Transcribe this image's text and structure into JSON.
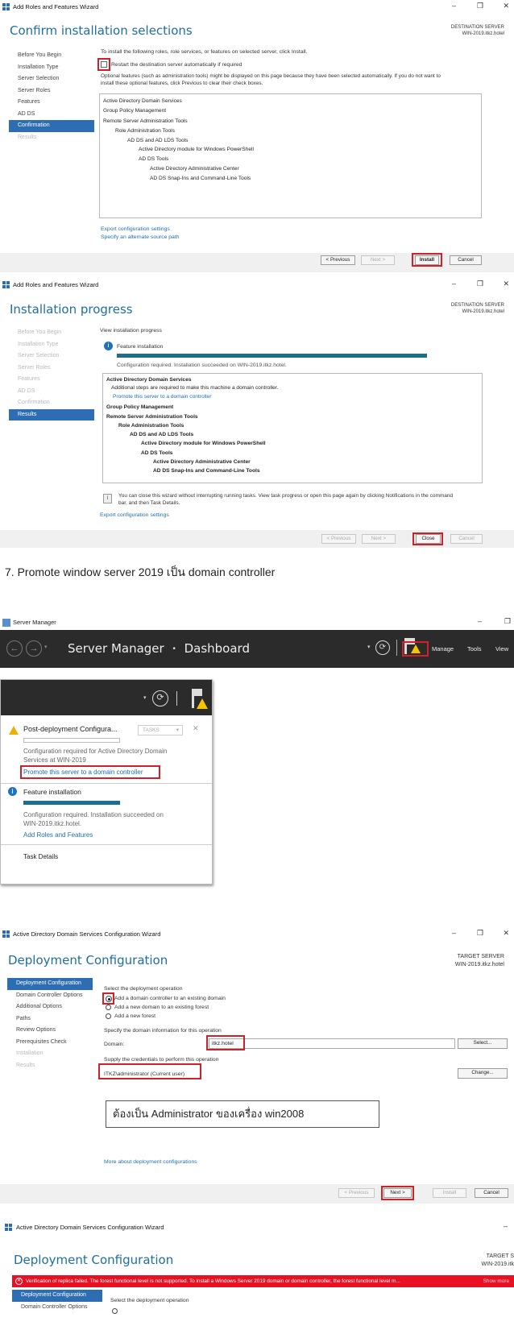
{
  "s1": {
    "window_title": "Add Roles and Features Wizard",
    "heading": "Confirm installation selections",
    "dest_label": "DESTINATION SERVER",
    "dest_server": "WIN-2019.itkz.hotel",
    "nav": [
      "Before You Begin",
      "Installation Type",
      "Server Selection",
      "Server Roles",
      "Features",
      "AD DS",
      "Confirmation",
      "Results"
    ],
    "intro": "To install the following roles, role services, or features on selected server, click Install.",
    "restart_label": "Restart the destination server automatically if required",
    "optional_text_1": "Optional features (such as administration tools) might be displayed on this page because they have been selected automatically. If you do not want to",
    "optional_text_2": "install these optional features, click Previous to clear their check boxes.",
    "items": [
      "Active Directory Domain Services",
      "Group Policy Management",
      "Remote Server Administration Tools",
      "Role Administration Tools",
      "AD DS and AD LDS Tools",
      "Active Directory module for Windows PowerShell",
      "AD DS Tools",
      "Active Directory Administrative Center",
      "AD DS Snap-Ins and Command-Line Tools"
    ],
    "export_link": "Export configuration settings",
    "alt_source_link": "Specify an alternate source path",
    "btn_previous": "< Previous",
    "btn_next": "Next >",
    "btn_install": "Install",
    "btn_cancel": "Cancel"
  },
  "s2": {
    "window_title": "Add Roles and Features Wizard",
    "heading": "Installation progress",
    "dest_label": "DESTINATION SERVER",
    "dest_server": "WIN-2019.itkz.hotel",
    "nav": [
      "Before You Begin",
      "Installation Type",
      "Server Selection",
      "Server Roles",
      "Features",
      "AD DS",
      "Confirmation",
      "Results"
    ],
    "view_progress": "View installation progress",
    "feature_installation": "Feature installation",
    "progress": 1.0,
    "status": "Configuration required. Installation succeeded on WIN-2019.itkz.hotel.",
    "items": [
      "Active Directory Domain Services",
      "Additional steps are required to make this machine a domain controller.",
      "Promote this server to a domain controller",
      "Group Policy Management",
      "Remote Server Administration Tools",
      "Role Administration Tools",
      "AD DS and AD LDS Tools",
      "Active Directory module for Windows PowerShell",
      "AD DS Tools",
      "Active Directory Administrative Center",
      "AD DS Snap-Ins and Command-Line Tools"
    ],
    "note_1": "You can close this wizard without interrupting running tasks. View task progress or open this page again by clicking Notifications in the command",
    "note_2": "bar, and then Task Details.",
    "export_link": "Export configuration settings",
    "btn_previous": "< Previous",
    "btn_next": "Next >",
    "btn_close": "Close",
    "btn_cancel": "Cancel"
  },
  "caption": "7. Promote window server 2019 เป็น domain controller",
  "s3": {
    "window_title": "Server Manager",
    "breadcrumb_app": "Server Manager",
    "breadcrumb_sep": "•",
    "breadcrumb_page": "Dashboard",
    "menu": [
      "Manage",
      "Tools",
      "View"
    ],
    "notif1_title": "Post-deployment Configura...",
    "tasks_label": "TASKS",
    "notif1_text_1": "Configuration required for Active Directory Domain",
    "notif1_text_2": "Services at WIN-2019",
    "notif1_link": "Promote this server to a domain controller",
    "notif2_title": "Feature installation",
    "notif2_progress": 1.0,
    "notif2_text_1": "Configuration required. Installation succeeded on",
    "notif2_text_2": "WIN-2019.itkz.hotel.",
    "notif2_link": "Add Roles and Features",
    "task_details": "Task Details"
  },
  "s4": {
    "window_title": "Active Directory Domain Services Configuration Wizard",
    "heading": "Deployment Configuration",
    "target_label": "TARGET SERVER",
    "target_server": "WIN-2019.itkz.hotel",
    "nav": [
      "Deployment Configuration",
      "Domain Controller Options",
      "Additional Options",
      "Paths",
      "Review Options",
      "Prerequisites Check",
      "Installation",
      "Results"
    ],
    "select_op": "Select the deployment operation",
    "options": [
      "Add a domain controller to an existing domain",
      "Add a new domain to an existing forest",
      "Add a new forest"
    ],
    "specify_domain": "Specify the domain information for this operation",
    "domain_label": "Domain:",
    "domain_value": "itkz.hotel",
    "btn_select": "Select...",
    "credentials_label": "Supply the credentials to perform this operation",
    "credentials_value": "ITKZ\\administrator (Current user)",
    "btn_change": "Change...",
    "annotation": "ต้องเป็น Administrator ของเครื่อง win2008",
    "more_link": "More about deployment configurations",
    "btn_previous": "< Previous",
    "btn_next": "Next >",
    "btn_install": "Install",
    "btn_cancel": "Cancel"
  },
  "s5": {
    "window_title": "Active Directory Domain Services Configuration Wizard",
    "heading": "Deployment Configuration",
    "target_label": "TARGET S",
    "target_server": "WIN-2019.itk",
    "error": "Verification of replica failed. The forest functional level is not supported. To install a Windows Server 2019 domain or domain controller, the forest functional level m...",
    "show_more": "Show more",
    "nav": [
      "Deployment Configuration",
      "Domain Controller Options"
    ],
    "select_op": "Select the deployment operation"
  },
  "colors": {
    "accent": "#2d6db4",
    "heading": "#1e6f9f",
    "highlight": "#d0202a",
    "error": "#e81123",
    "dark_bar": "#2b2b2b"
  }
}
